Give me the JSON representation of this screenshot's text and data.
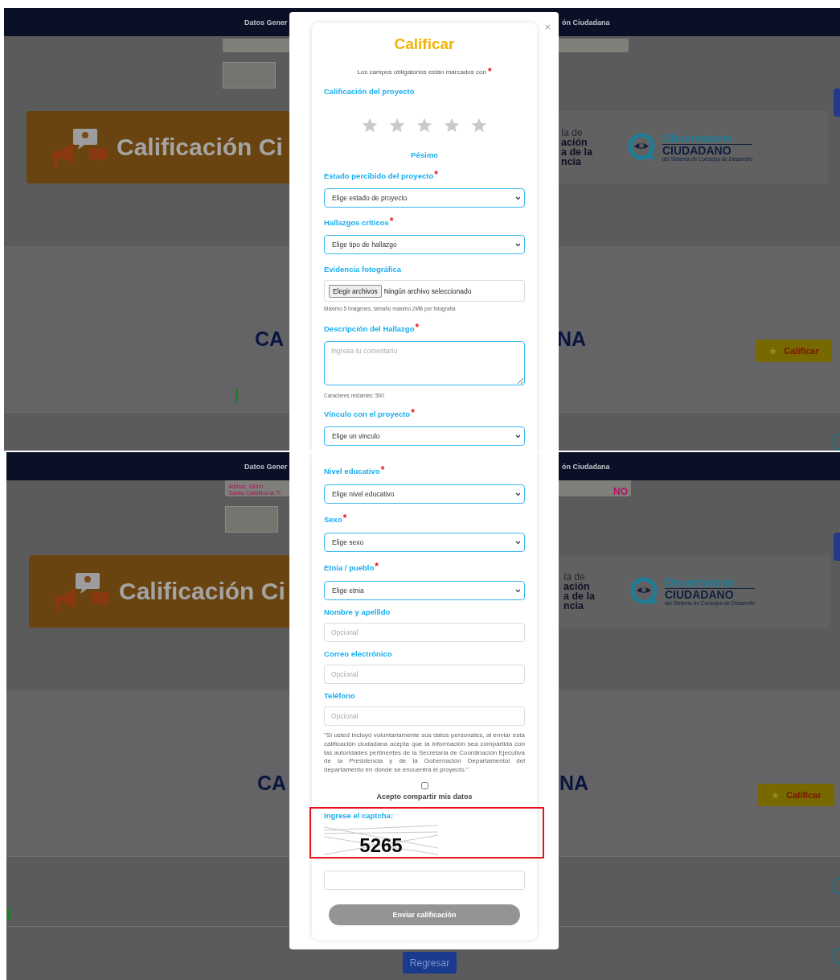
{
  "screens": [
    {
      "nav": {
        "left": "Datos Gener",
        "right": "ón Ciudadana"
      },
      "banner": {
        "title": "Calificación Ci"
      },
      "partner_logo": {
        "light": "ía de",
        "bold_lines": [
          "ación",
          "a de la",
          "ncia"
        ]
      },
      "observatorio_logo": {
        "line1": "Observatorio",
        "line2": "CIUDADANO",
        "line3": "del Sistema de Consejos de Desarrollo"
      },
      "heading": {
        "left": "CA",
        "right": "NA"
      },
      "rate_button": "Calificar",
      "modal": {
        "close": "×",
        "title": "Calificar",
        "required_note": {
          "text": "Los campos obligatorios están marcados con",
          "mark": "*"
        },
        "rating": {
          "label": "Calificación del proyecto",
          "stars": 0,
          "caption": "Pésimo"
        },
        "fields": [
          {
            "kind": "select",
            "label": "Estado percibido del proyecto",
            "mark": "*",
            "value": "Elige estado de proyecto"
          },
          {
            "kind": "select",
            "label": "Hallazgos críticos",
            "mark": "*",
            "value": "Elige tipo de hallazgo"
          },
          {
            "kind": "file",
            "label": "Evidencia fotográfica",
            "button": "Elegir archivos",
            "status": "Ningún archivo seleccionado",
            "hint": "Máximo 5 imagenes, tamaño máximo 2MB por fotografía"
          },
          {
            "kind": "textarea",
            "label": "Descripción del Hallazgo",
            "mark": "*",
            "placeholder": "Ingresa tu comentario",
            "hint": "Caracteres restantes: 500"
          },
          {
            "kind": "select",
            "label": "Vínculo con el proyecto",
            "mark": "*",
            "value": "Elige un vinculo"
          }
        ]
      }
    },
    {
      "nav": {
        "left": "Datos Gener",
        "right": "ón Ciudadana"
      },
      "photo_overlay": {
        "lines": [
          "Altitud: 183m",
          "Santa Catalina la Ti"
        ],
        "badge": "NO"
      },
      "banner": {
        "title": "Calificación Ci"
      },
      "partner_logo": {
        "light": "ía de",
        "bold_lines": [
          "ación",
          "a de la",
          "ncia"
        ]
      },
      "observatorio_logo": {
        "line1": "Observatorio",
        "line2": "CIUDADANO",
        "line3": "del Sistema de Consejos de Desarrollo"
      },
      "heading": {
        "left": "CA",
        "right": "NA"
      },
      "rate_button": "Calificar",
      "back_button": "Regresar",
      "modal": {
        "fields": [
          {
            "kind": "select",
            "label": "Nivel educativo",
            "mark": "*",
            "value": "Elige nivel educativo"
          },
          {
            "kind": "select",
            "label": "Sexo",
            "mark": "*",
            "value": "Elige sexo"
          },
          {
            "kind": "select",
            "label": "Etnia / pueblo",
            "mark": "*",
            "value": "Elige etnia"
          },
          {
            "kind": "text",
            "label": "Nombre y apellido",
            "placeholder": "Opcional"
          },
          {
            "kind": "text",
            "label": "Correo electrónico",
            "placeholder": "Opcional"
          },
          {
            "kind": "text",
            "label": "Teléfono",
            "placeholder": "Opcional"
          }
        ],
        "notice": "\"Si usted incluyó voluntariamente sus datos personales, al enviar esta calificación ciudadana acepta que la información sea compartida con las autoridades pertinentes de la Secretaría de Coordinación Ejecutiva de la Presidencia y de la Gobernación Departamental del departamento en donde se encuentra el proyecto.\"",
        "consent": {
          "label": "Acepto compartir mis datos",
          "checked": false
        },
        "captcha": {
          "label": "Ingrese el captcha:",
          "code": "5265",
          "highlighted": true
        },
        "submit": {
          "label": "Enviar calificación",
          "disabled": true
        }
      }
    }
  ]
}
